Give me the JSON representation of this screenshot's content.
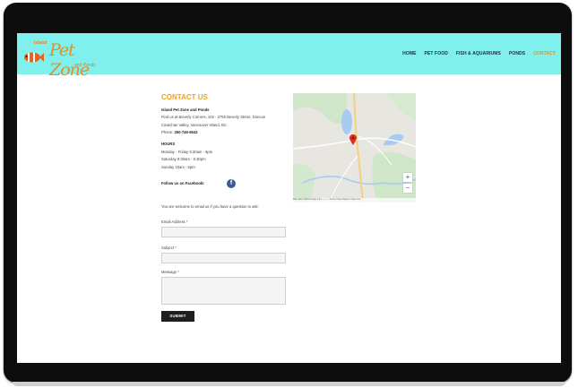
{
  "header": {
    "logo_top": "Island",
    "logo_script": "Pet Zone",
    "logo_sub": "and Ponds",
    "nav": [
      {
        "label": "HOME",
        "active": false
      },
      {
        "label": "PET FOOD",
        "active": false
      },
      {
        "label": "FISH & AQUARIUMS",
        "active": false
      },
      {
        "label": "PONDS",
        "active": false
      },
      {
        "label": "CONTACT",
        "active": true
      }
    ]
  },
  "contact": {
    "heading": "CONTACT US",
    "business_name": "Island Pet Zone and Ponds",
    "address_line1": "Find us at Beverly Corners, 102 - 2755 Beverly Street, Duncan",
    "address_line2": "Cowichan Valley, Vancouver Island, BC",
    "phone_label": "Phone:",
    "phone": "250-746-5542",
    "hours_heading": "HOURS",
    "hours": [
      "Monday - Friday 9:30am - 6pm",
      "Saturday 9:30am - 5:30pm",
      "Sunday 10am - 5pm"
    ],
    "follow": "Follow us on Facebook!",
    "facebook_glyph": "f"
  },
  "form": {
    "intro": "You are welcome to email us if you have a question to ask:",
    "email_label": "Email Address *",
    "subject_label": "Subject *",
    "message_label": "Message *",
    "submit": "SUBMIT"
  },
  "map": {
    "zoom_in": "+",
    "zoom_out": "−",
    "footer": "Map data ©2019 Google   2 km ———   Terms of Use   Report a map error"
  },
  "colors": {
    "header_bg": "#7ff0ec",
    "accent": "#f0a020",
    "pin": "#d93025"
  }
}
